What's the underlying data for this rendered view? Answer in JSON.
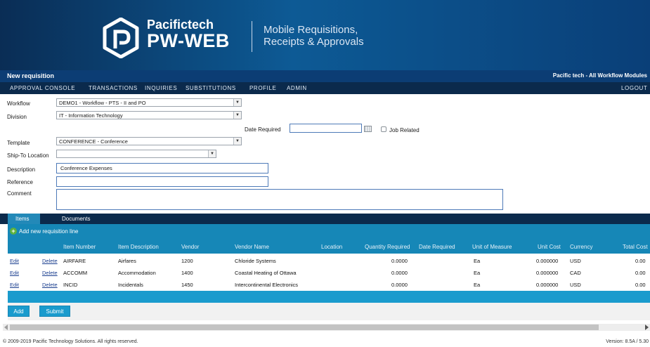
{
  "brand": {
    "name": "Pacifictech",
    "product": "PW-WEB",
    "tagline_line1": "Mobile Requisitions,",
    "tagline_line2": "Receipts & Approvals"
  },
  "titlebar": {
    "title": "New requisition",
    "right": "Pacific tech - All Workflow Modules"
  },
  "menu": {
    "items": [
      "APPROVAL CONSOLE",
      "TRANSACTIONS",
      "INQUIRIES",
      "SUBSTITUTIONS",
      "PROFILE",
      "ADMIN"
    ],
    "logout": "LOGOUT"
  },
  "form": {
    "workflow_label": "Workflow",
    "workflow_value": "DEMO1 - Workflow - PTS - II and PO",
    "division_label": "Division",
    "division_value": "IT - Information Technology",
    "date_required_label": "Date Required",
    "date_required_value": "",
    "job_related_label": "Job Related",
    "template_label": "Template",
    "template_value": "CONFERENCE - Conference",
    "shipto_label": "Ship-To Location",
    "shipto_value": "",
    "description_label": "Description",
    "description_value": "Conference Expenses",
    "reference_label": "Reference",
    "reference_value": "",
    "comment_label": "Comment",
    "comment_value": ""
  },
  "tabs": {
    "items": "Items",
    "documents": "Documents"
  },
  "add_line_label": "Add new requisition line",
  "table": {
    "headers": [
      "Item Number",
      "Item Description",
      "Vendor",
      "Vendor Name",
      "Location",
      "Quantity Required",
      "Date Required",
      "Unit of Measure",
      "Unit Cost",
      "Currency",
      "Total Cost"
    ],
    "edit_label": "Edit",
    "delete_label": "Delete",
    "rows": [
      {
        "item": "AIRFARE",
        "desc": "Airfares",
        "vendor": "1200",
        "vendor_name": "Chloride Systems",
        "location": "",
        "qty": "0.0000",
        "date": "",
        "uom": "Ea",
        "unit_cost": "0.000000",
        "currency": "USD",
        "total": "0.00"
      },
      {
        "item": "ACCOMM",
        "desc": "Accommodation",
        "vendor": "1400",
        "vendor_name": "Coastal Heating of Ottawa",
        "location": "",
        "qty": "0.0000",
        "date": "",
        "uom": "Ea",
        "unit_cost": "0.000000",
        "currency": "CAD",
        "total": "0.00"
      },
      {
        "item": "INCID",
        "desc": "Incidentals",
        "vendor": "1450",
        "vendor_name": "Intercontinental Electronics",
        "location": "",
        "qty": "0.0000",
        "date": "",
        "uom": "Ea",
        "unit_cost": "0.000000",
        "currency": "USD",
        "total": "0.00"
      }
    ]
  },
  "buttons": {
    "add": "Add",
    "submit": "Submit"
  },
  "footer": {
    "copyright": "© 2009-2019 Pacific Technology Solutions. All rights reserved.",
    "version": "Version: 8.5A / 5.30"
  },
  "colors": {
    "header_navy": "#0c3d74",
    "menu_dark": "#0b2a4c",
    "table_blue": "#1687b7",
    "button_blue": "#1a9bcd",
    "add_icon_green": "#5cb13d"
  }
}
